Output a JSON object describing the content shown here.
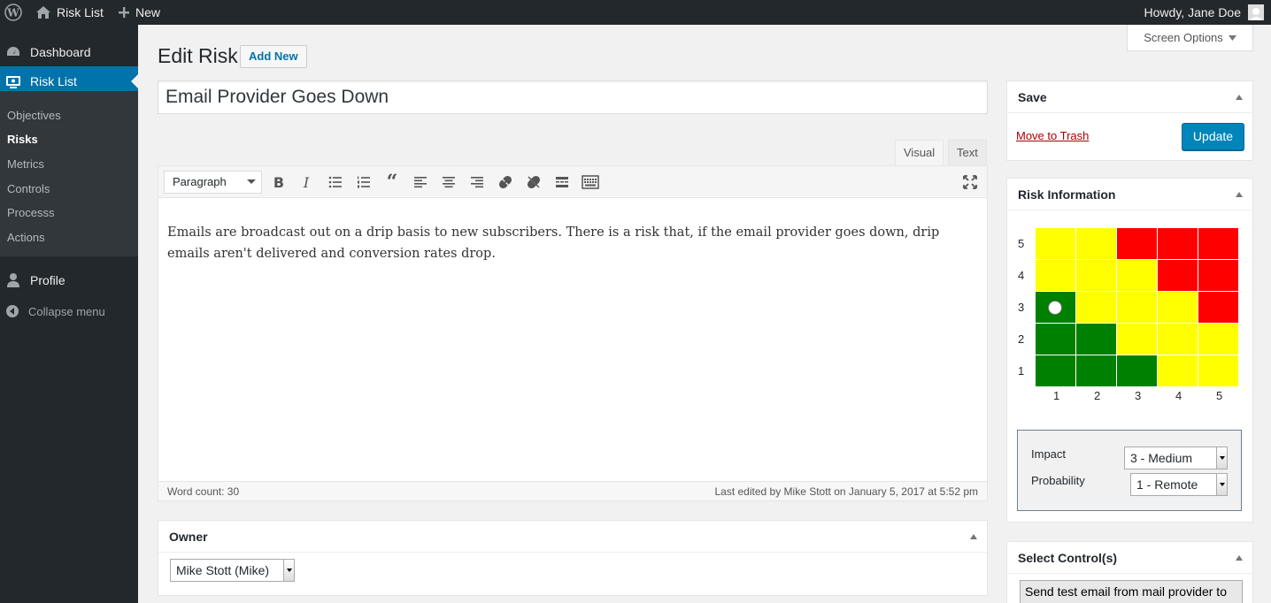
{
  "adminbar": {
    "site_name": "Risk List",
    "new_label": "New",
    "howdy": "Howdy, Jane Doe"
  },
  "sidebar": {
    "dashboard": "Dashboard",
    "risk_list": "Risk List",
    "submenu": [
      "Objectives",
      "Risks",
      "Metrics",
      "Controls",
      "Processs",
      "Actions"
    ],
    "profile": "Profile",
    "collapse": "Collapse menu"
  },
  "screen_options": "Screen Options",
  "page": {
    "title": "Edit Risk",
    "add_new": "Add New",
    "post_title": "Email Provider Goes Down"
  },
  "editor": {
    "tab_visual": "Visual",
    "tab_text": "Text",
    "format": "Paragraph",
    "content": "Emails are broadcast out on a drip basis to new subscribers. There is a risk that, if the email provider goes down, drip emails aren't delivered and conversion rates drop.",
    "word_count": "Word count: 30",
    "last_edited": "Last edited by Mike Stott on January 5, 2017 at 5:52 pm"
  },
  "owner_box": {
    "title": "Owner",
    "selected": "Mike Stott (Mike)"
  },
  "save_box": {
    "title": "Save",
    "trash": "Move to Trash",
    "update": "Update"
  },
  "risk_info": {
    "title": "Risk Information",
    "y_labels": [
      "5",
      "4",
      "3",
      "2",
      "1"
    ],
    "x_labels": [
      "1",
      "2",
      "3",
      "4",
      "5"
    ],
    "matrix_rows_top_to_bottom": [
      [
        "yellow",
        "yellow",
        "red",
        "red",
        "red"
      ],
      [
        "yellow",
        "yellow",
        "yellow",
        "red",
        "red"
      ],
      [
        "green",
        "yellow",
        "yellow",
        "yellow",
        "red"
      ],
      [
        "green",
        "green",
        "yellow",
        "yellow",
        "yellow"
      ],
      [
        "green",
        "green",
        "green",
        "yellow",
        "yellow"
      ]
    ],
    "colors": {
      "green": "#008000",
      "yellow": "#ffff00",
      "red": "#ff0000"
    },
    "marker": {
      "impact": 1,
      "probability": 3
    },
    "impact_label": "Impact",
    "impact_value": "3 - Medium",
    "probability_label": "Probability",
    "probability_value": "1 - Remote"
  },
  "controls_box": {
    "title": "Select Control(s)",
    "first_option": "Send test email from mail provider to"
  }
}
